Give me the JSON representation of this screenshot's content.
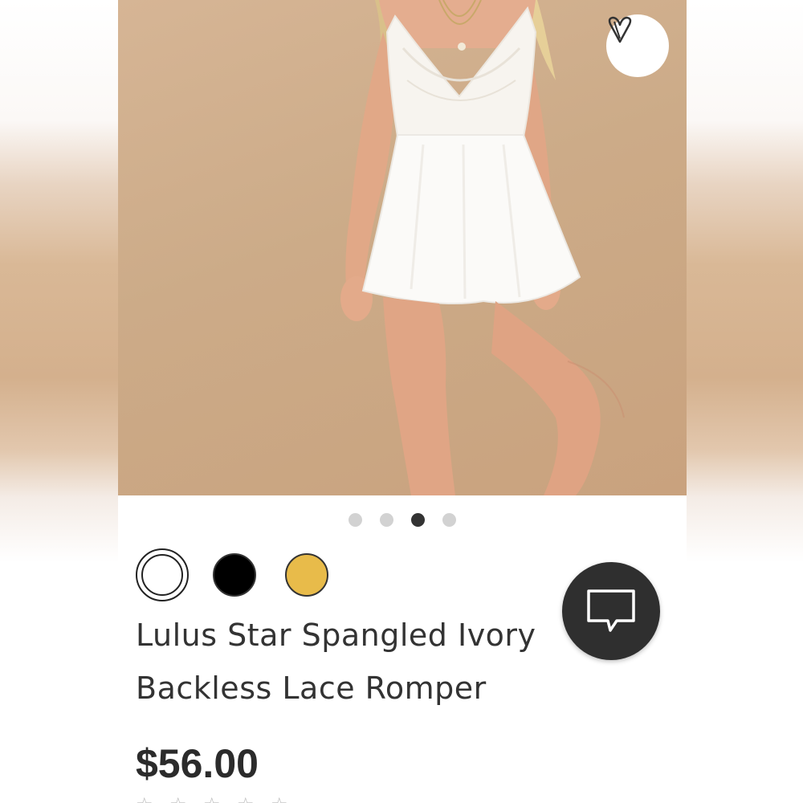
{
  "product": {
    "title_line1": "Lulus Star Spangled Ivory",
    "title_line2": "Backless Lace Romper",
    "price": "$56.00",
    "image_alt": "White lace romper on model",
    "carousel": {
      "total": 4,
      "active_index": 2
    },
    "colors": [
      {
        "name": "ivory",
        "hex": "#ffffff",
        "selected": true
      },
      {
        "name": "black",
        "hex": "#000000",
        "selected": false
      },
      {
        "name": "mustard",
        "hex": "#e8bb4a",
        "selected": false
      }
    ],
    "rating_stars": 5
  },
  "icons": {
    "like": "heart-icon",
    "chat": "chat-bubble-icon"
  },
  "theme": {
    "hero_bg": "#d6b595",
    "chat_button_bg": "#2f2f2f",
    "dot_active": "#333333",
    "dot_inactive": "#d2d2d2"
  }
}
